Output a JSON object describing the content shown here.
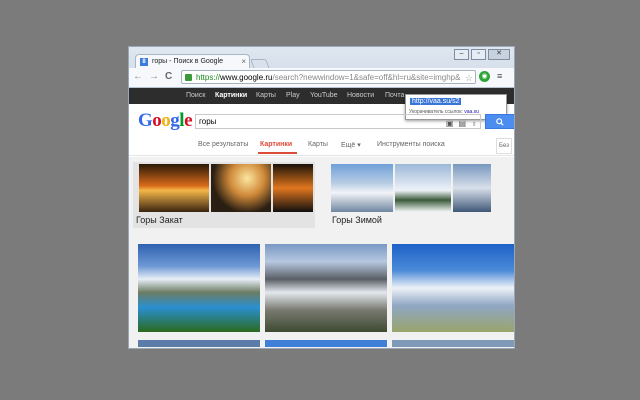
{
  "window": {
    "controls": [
      "–",
      "▫",
      "✕"
    ]
  },
  "tab": {
    "title": "горы - Поиск в Google",
    "favicon_letter": "8",
    "close": "×"
  },
  "nav": {
    "back": "←",
    "forward": "→",
    "reload": "C",
    "url_scheme": "https://",
    "url_host": "www.google.ru",
    "url_path": "/search?newwindow=1&safe=off&hl=ru&site=imghp&",
    "star": "☆",
    "menu": "≡"
  },
  "gbar": {
    "items": [
      "Поиск",
      "Картинки",
      "Карты",
      "Play",
      "YouTube",
      "Новости",
      "Почта"
    ],
    "active_index": 1
  },
  "popup": {
    "short_url": "http://vaa.su/s2",
    "hint": "Укорачиватель ссылок:",
    "hint_link": "vaa.su"
  },
  "search": {
    "logo_letters": [
      "G",
      "o",
      "o",
      "g",
      "l",
      "e"
    ],
    "logo_colors": [
      "#3369e8",
      "#d50f25",
      "#eeb211",
      "#3369e8",
      "#009925",
      "#d50f25"
    ],
    "query": "горы",
    "icons": [
      "camera-icon",
      "keyboard-icon",
      "mic-icon"
    ],
    "button_icon": "search-icon"
  },
  "tabs": {
    "items": [
      "Все результаты",
      "Картинки",
      "Карты",
      "Ещё ▾",
      "Инструменты поиска"
    ],
    "active_index": 1,
    "right_label": "Без"
  },
  "clusters": [
    {
      "label": "Горы Закат"
    },
    {
      "label": "Горы Зимой"
    }
  ],
  "colors": {
    "active_red": "#dd4b39",
    "search_blue": "#4c8ef0",
    "gbar_bg": "#2d2d2d"
  }
}
